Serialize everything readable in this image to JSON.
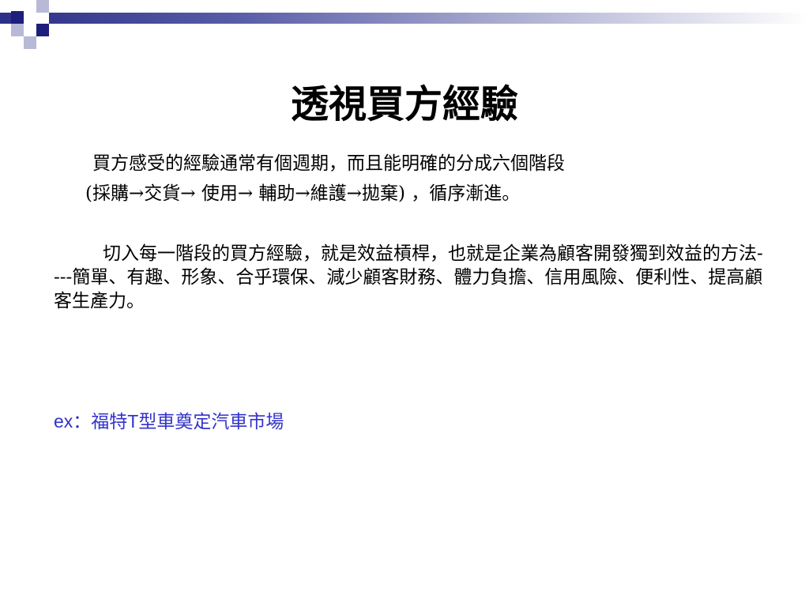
{
  "slide": {
    "title": "透視買方經驗",
    "paragraph1": {
      "line1": "買方感受的經驗通常有個週期，而且能明確的分成六個階段",
      "line2": "(採購→交貨→ 使用→ 輔助→維護→拋棄) ，循序漸進。"
    },
    "paragraph2": "切入每一階段的買方經驗，就是效益槓桿，也就是企業為顧客開發獨到效益的方法----簡單、有趣、形象、合乎環保、減少顧客財務、體力負擔、信用風險、便利性、提高顧客生產力。",
    "example": {
      "prefix": "ex：",
      "text_a": "福特",
      "text_b": "T",
      "text_c": "型車奠定汽車市場"
    }
  },
  "colors": {
    "title_text": "#000000",
    "body_text": "#000000",
    "example_text": "#3333cc",
    "accent_dark": "#1d1f7a",
    "accent_light": "#b7b9d6"
  }
}
